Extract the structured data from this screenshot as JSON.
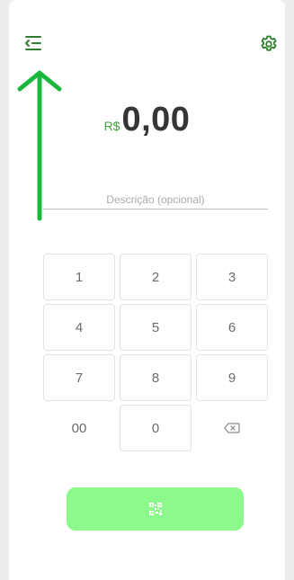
{
  "header": {
    "menu_icon": "menu-collapse-icon",
    "settings_icon": "gear-icon"
  },
  "amount": {
    "currency": "R$",
    "value": "0,00"
  },
  "description": {
    "placeholder": "Descrição (opcional)",
    "value": ""
  },
  "keypad": {
    "keys": [
      "1",
      "2",
      "3",
      "4",
      "5",
      "6",
      "7",
      "8",
      "9",
      "00",
      "0"
    ],
    "backspace_icon": "backspace-icon"
  },
  "action": {
    "icon": "qr-code-icon"
  },
  "colors": {
    "accent": "#3fa33f",
    "button": "#8bf98b",
    "arrow": "#19b83c",
    "amount_text": "#353535"
  }
}
